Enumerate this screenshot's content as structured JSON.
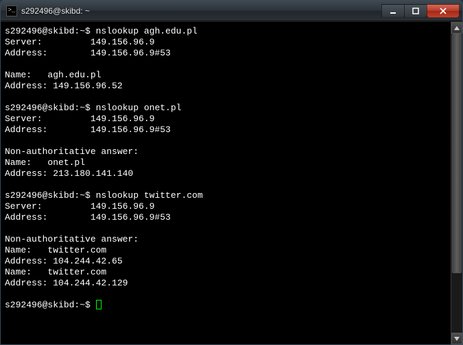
{
  "window": {
    "title": "s292496@skibd: ~"
  },
  "prompt": "s292496@skibd:~$ ",
  "blocks": [
    {
      "cmd": "nslookup agh.edu.pl",
      "lines": [
        "Server:         149.156.96.9",
        "Address:        149.156.96.9#53",
        "",
        "Name:   agh.edu.pl",
        "Address: 149.156.96.52",
        ""
      ]
    },
    {
      "cmd": "nslookup onet.pl",
      "lines": [
        "Server:         149.156.96.9",
        "Address:        149.156.96.9#53",
        "",
        "Non-authoritative answer:",
        "Name:   onet.pl",
        "Address: 213.180.141.140",
        ""
      ]
    },
    {
      "cmd": "nslookup twitter.com",
      "lines": [
        "Server:         149.156.96.9",
        "Address:        149.156.96.9#53",
        "",
        "Non-authoritative answer:",
        "Name:   twitter.com",
        "Address: 104.244.42.65",
        "Name:   twitter.com",
        "Address: 104.244.42.129",
        ""
      ]
    }
  ]
}
